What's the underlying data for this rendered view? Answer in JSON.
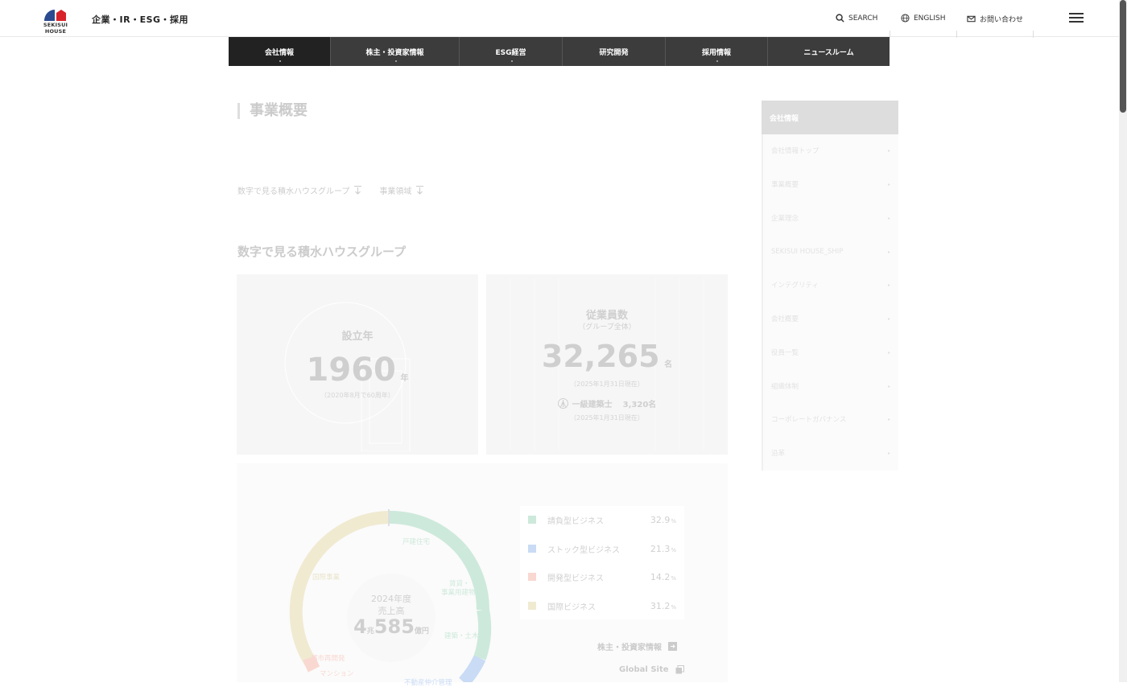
{
  "header": {
    "logo_text": "SEKISUI HOUSE",
    "site_title": "企業・IR・ESG・採用",
    "search_label": "SEARCH",
    "english_label": "ENGLISH",
    "contact_label": "お問い合わせ",
    "menu_icon": "hamburger-icon"
  },
  "gnav": {
    "items": [
      {
        "label": "会社情報",
        "active": true
      },
      {
        "label": "株主・投資家情報",
        "active": false
      },
      {
        "label": "ESG経営",
        "active": false
      },
      {
        "label": "研究開発",
        "active": false
      },
      {
        "label": "採用情報",
        "active": false
      },
      {
        "label": "ニュースルーム",
        "active": false
      }
    ]
  },
  "main": {
    "page_title": "事業概要",
    "anchors": [
      "数字で見る積水ハウスグループ",
      "事業領域"
    ],
    "section_title": "数字で見る積水ハウスグループ",
    "founded": {
      "label": "設立年",
      "value": "1960",
      "unit": "年",
      "note": "（2020年8月で60周年）"
    },
    "employees": {
      "label": "従業員数",
      "sublabel": "（グループ全体）",
      "value": "32,265",
      "unit": "名",
      "note": "（2025年1月31日現在）",
      "architect_label": "一級建築士",
      "architect_value": "3,320名",
      "architect_note": "（2025年1月31日現在）"
    },
    "sales": {
      "center_line1": "2024年度",
      "center_line2": "売上高",
      "amount_a": "4",
      "unit_a": "兆",
      "amount_b": "585",
      "unit_b": "億円",
      "ring_labels": [
        "戸建住宅",
        "賃貸・",
        "事業用建物",
        "建築・土木",
        "国際事業",
        "都市再開発",
        "マンション",
        "不動産仲介管理"
      ]
    },
    "legend": [
      {
        "label": "請負型ビジネス",
        "value": "32.9",
        "unit": "%",
        "color": "#4caf7d"
      },
      {
        "label": "ストック型ビジネス",
        "value": "21.3",
        "unit": "%",
        "color": "#3d7fd9"
      },
      {
        "label": "開発型ビジネス",
        "value": "14.2",
        "unit": "%",
        "color": "#e8745a"
      },
      {
        "label": "国際ビジネス",
        "value": "31.2",
        "unit": "%",
        "color": "#c9b25c"
      }
    ],
    "links": {
      "investors": "株主・投資家情報",
      "global": "Global Site"
    }
  },
  "sidenav": {
    "head": "会社情報",
    "items": [
      "会社情報トップ",
      "事業概要",
      "企業理念",
      "SEKISUI HOUSE_SHIP",
      "インテグリティ",
      "会社概要",
      "役員一覧",
      "組織体制",
      "コーポレートガバナンス",
      "沿革"
    ]
  }
}
